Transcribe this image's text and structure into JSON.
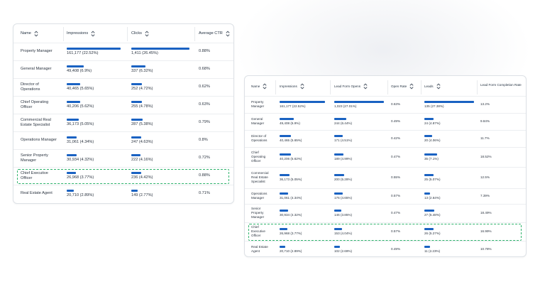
{
  "table1": {
    "headers": {
      "name": "Name",
      "impressions": "Impressions",
      "clicks": "Clicks",
      "ctr": "Average CTR"
    },
    "rows": [
      {
        "name": [
          "Property Manager"
        ],
        "impressions": "161,177 (22.52%)",
        "imp_pct": 1.0,
        "clicks": "1,411 (26.45%)",
        "clk_pct": 1.0,
        "ctr": "0.88%"
      },
      {
        "name": [
          "General Manager"
        ],
        "impressions": "49,408 (6.9%)",
        "imp_pct": 0.31,
        "clicks": "337 (6.32%)",
        "clk_pct": 0.24,
        "ctr": "0.68%"
      },
      {
        "name": [
          "Director of",
          "Operations"
        ],
        "impressions": "40,465 (5.65%)",
        "imp_pct": 0.25,
        "clicks": "252 (4.72%)",
        "clk_pct": 0.18,
        "ctr": "0.62%"
      },
      {
        "name": [
          "Chief Operating",
          "Officer"
        ],
        "impressions": "40,206 (5.62%)",
        "imp_pct": 0.25,
        "clicks": "255 (4.78%)",
        "clk_pct": 0.18,
        "ctr": "0.63%"
      },
      {
        "name": [
          "Commercial Real",
          "Estate Specialist"
        ],
        "impressions": "36,173 (5.05%)",
        "imp_pct": 0.22,
        "clicks": "287 (5.38%)",
        "clk_pct": 0.2,
        "ctr": "0.79%"
      },
      {
        "name": [
          "Operations Manager"
        ],
        "impressions": "31,061 (4.34%)",
        "imp_pct": 0.19,
        "clicks": "247 (4.63%)",
        "clk_pct": 0.175,
        "ctr": "0.8%"
      },
      {
        "name": [
          "Senior Property",
          "Manager"
        ],
        "impressions": "30,934 (4.32%)",
        "imp_pct": 0.19,
        "clicks": "222 (4.16%)",
        "clk_pct": 0.16,
        "ctr": "0.72%"
      },
      {
        "name": [
          "Chief Executive",
          "Officer"
        ],
        "impressions": "26,968 (3.77%)",
        "imp_pct": 0.17,
        "clicks": "236 (4.42%)",
        "clk_pct": 0.17,
        "ctr": "0.88%",
        "highlight": true
      },
      {
        "name": [
          "Real Estate Agent"
        ],
        "impressions": "20,710 (2.89%)",
        "imp_pct": 0.13,
        "clicks": "149 (2.77%)",
        "clk_pct": 0.105,
        "ctr": "0.71%"
      }
    ]
  },
  "table2": {
    "headers": {
      "name": "Name",
      "impressions": "Impressions",
      "opens": "Lead Form Opens",
      "open_rate": "Open Rate",
      "leads": "Leads",
      "completion": "Lead Form Completion Rate"
    },
    "rows": [
      {
        "name": [
          "Property",
          "Manager"
        ],
        "impressions": "161,177 (22.52%)",
        "imp_pct": 1.0,
        "opens": "1,023 (27.01%)",
        "opn_pct": 1.0,
        "open_rate": "0.63%",
        "leads": "135 (27.38%)",
        "led_pct": 1.0,
        "completion": "13.2%"
      },
      {
        "name": [
          "General",
          "Manager"
        ],
        "impressions": "49,408 (6.9%)",
        "imp_pct": 0.31,
        "opens": "244 (6.44%)",
        "opn_pct": 0.24,
        "open_rate": "0.49%",
        "leads": "24 (4.87%)",
        "led_pct": 0.18,
        "completion": "9.84%"
      },
      {
        "name": [
          "Director of",
          "Operations"
        ],
        "impressions": "40,465 (5.65%)",
        "imp_pct": 0.25,
        "opens": "171 (4.51%)",
        "opn_pct": 0.17,
        "open_rate": "0.42%",
        "leads": "20 (4.06%)",
        "led_pct": 0.15,
        "completion": "11.7%"
      },
      {
        "name": [
          "Chief",
          "Operating",
          "Officer"
        ],
        "impressions": "40,206 (5.62%)",
        "imp_pct": 0.25,
        "opens": "189 (4.99%)",
        "opn_pct": 0.185,
        "open_rate": "0.47%",
        "leads": "35 (7.1%)",
        "led_pct": 0.26,
        "completion": "18.52%"
      },
      {
        "name": [
          "Commercial",
          "Real Estate",
          "Specialist"
        ],
        "impressions": "36,173 (5.05%)",
        "imp_pct": 0.22,
        "opens": "200 (5.28%)",
        "opn_pct": 0.195,
        "open_rate": "0.55%",
        "leads": "25 (5.07%)",
        "led_pct": 0.185,
        "completion": "12.5%"
      },
      {
        "name": [
          "Operations",
          "Manager"
        ],
        "impressions": "31,061 (4.34%)",
        "imp_pct": 0.19,
        "opens": "176 (4.65%)",
        "opn_pct": 0.17,
        "open_rate": "0.57%",
        "leads": "13 (2.64%)",
        "led_pct": 0.1,
        "completion": "7.39%"
      },
      {
        "name": [
          "Senior",
          "Property",
          "Manager"
        ],
        "impressions": "30,934 (4.32%)",
        "imp_pct": 0.19,
        "opens": "146 (3.85%)",
        "opn_pct": 0.14,
        "open_rate": "0.47%",
        "leads": "27 (5.48%)",
        "led_pct": 0.2,
        "completion": "18.49%"
      },
      {
        "name": [
          "Chief",
          "Executive",
          "Officer"
        ],
        "impressions": "26,968 (3.77%)",
        "imp_pct": 0.17,
        "opens": "153 (4.04%)",
        "opn_pct": 0.15,
        "open_rate": "0.57%",
        "leads": "26 (5.27%)",
        "led_pct": 0.19,
        "completion": "16.99%",
        "highlight": true
      },
      {
        "name": [
          "Real Estate",
          "Agent"
        ],
        "impressions": "20,710 (2.89%)",
        "imp_pct": 0.13,
        "opens": "102 (2.69%)",
        "opn_pct": 0.1,
        "open_rate": "0.49%",
        "leads": "11 (2.23%)",
        "led_pct": 0.08,
        "completion": "10.78%"
      }
    ]
  }
}
